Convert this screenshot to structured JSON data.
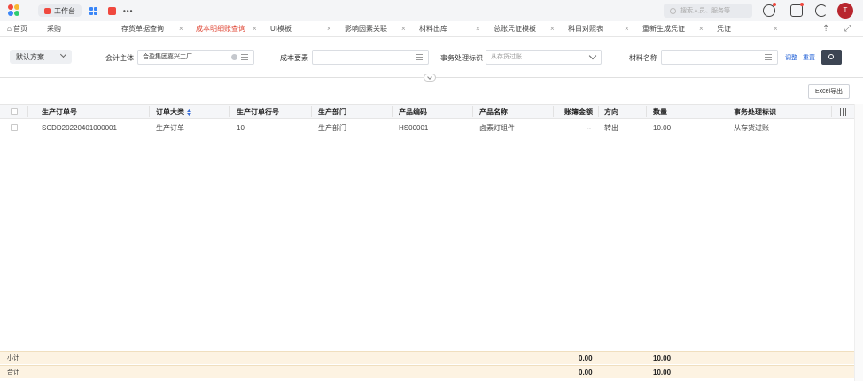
{
  "topbar": {
    "workbench_label": "工作台",
    "more_label": "•••",
    "search_placeholder": "搜索人员、服务等",
    "avatar_initial": "T"
  },
  "tabs": [
    {
      "label": "首页",
      "closable": false
    },
    {
      "label": "采购",
      "closable": false
    },
    {
      "label": "存货单据查询",
      "closable": true
    },
    {
      "label": "成本明细账查询",
      "closable": true,
      "active": true
    },
    {
      "label": "UI模板",
      "closable": true
    },
    {
      "label": "影响因素关联",
      "closable": true
    },
    {
      "label": "材料出库",
      "closable": true
    },
    {
      "label": "总账凭证模板",
      "closable": true
    },
    {
      "label": "科目对照表",
      "closable": true
    },
    {
      "label": "重新生成凭证",
      "closable": true
    },
    {
      "label": "凭证",
      "closable": true
    }
  ],
  "tab_close_glyph": "×",
  "filters": {
    "scheme_label": "默认方案",
    "accounting_entity_label": "会计主体",
    "accounting_entity_value": "合盈集团嘉兴工厂",
    "cost_element_label": "成本要素",
    "cost_element_value": "",
    "transaction_label": "事务处理标识",
    "transaction_value": "从存货过账",
    "material_label": "材料名称",
    "material_value": "",
    "adjust_label": "调整",
    "reset_label": "重置"
  },
  "toolbar": {
    "export_label": "Excel导出"
  },
  "table": {
    "columns": [
      "生产订单号",
      "订单大类",
      "生产订单行号",
      "生产部门",
      "产品编码",
      "产品名称",
      "账簿金额",
      "方向",
      "数量",
      "事务处理标识"
    ],
    "rows": [
      [
        "SCDD20220401000001",
        "生产订单",
        "10",
        "生产部门",
        "HS00001",
        "卤素灯组件",
        "--",
        "转出",
        "10.00",
        "从存货过账"
      ]
    ]
  },
  "summary": {
    "subtotal_label": "小计",
    "subtotal_amount": "0.00",
    "subtotal_qty": "10.00",
    "total_label": "合计",
    "total_amount": "0.00",
    "total_qty": "10.00"
  },
  "colors": {
    "accent": "#e04b3a",
    "link": "#1f5fd6",
    "summary_bg": "#fdf3e2",
    "search_btn": "#3c4553"
  }
}
